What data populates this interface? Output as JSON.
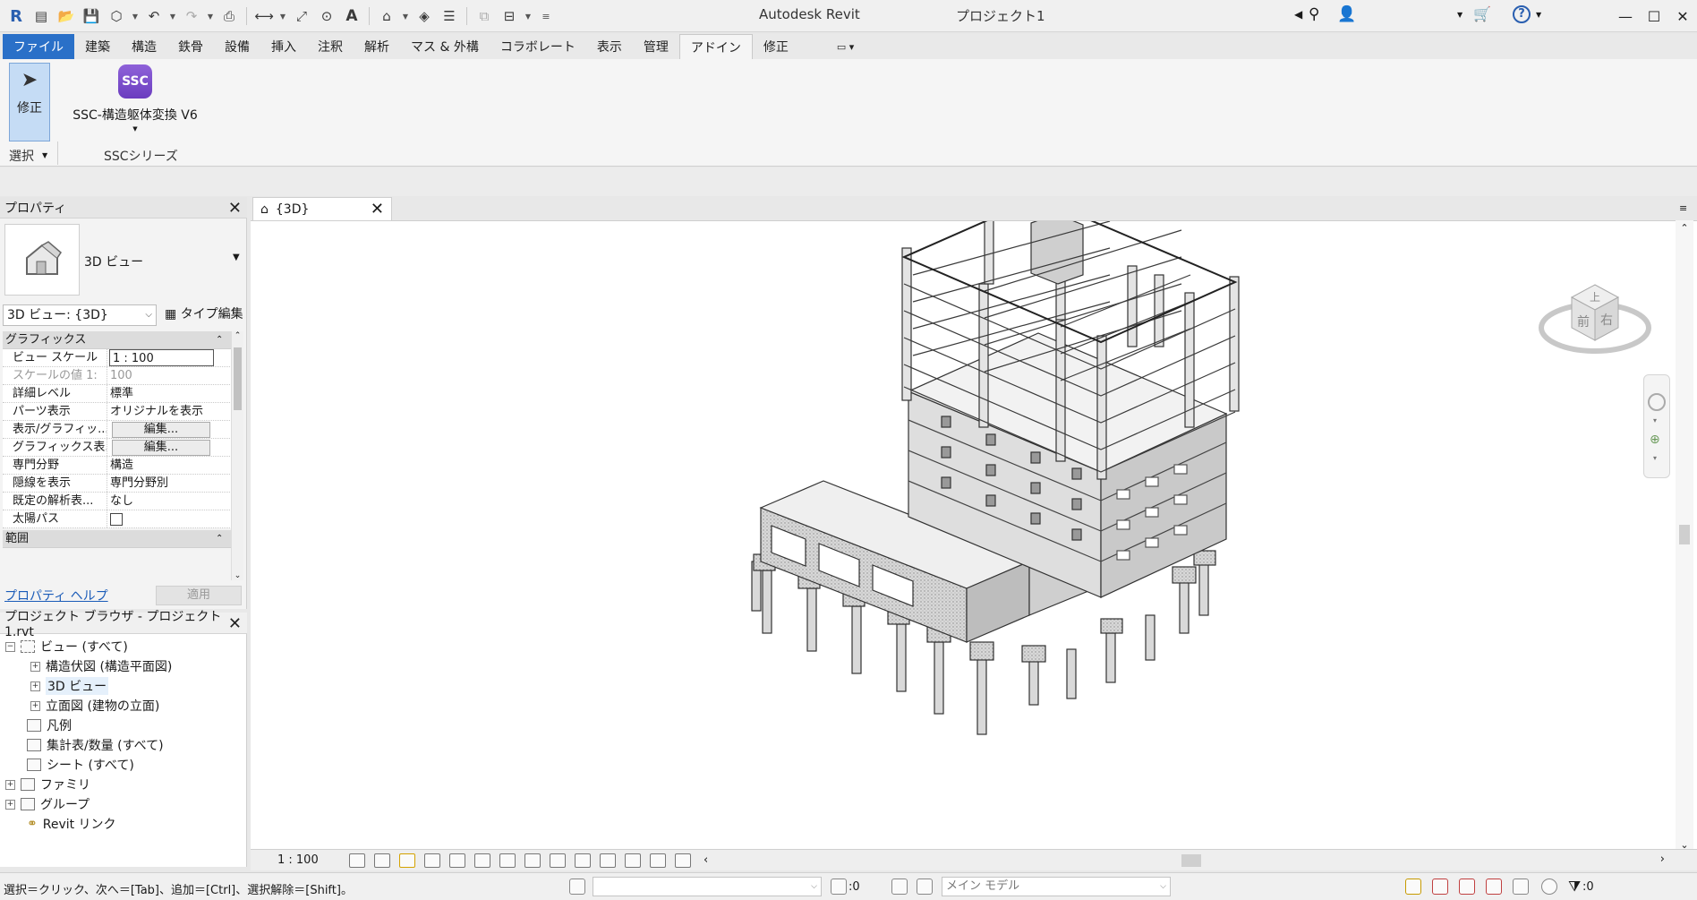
{
  "titlebar": {
    "app_title": "Autodesk Revit",
    "project_title": "プロジェクト1"
  },
  "menu": {
    "tabs": [
      "ファイル",
      "建築",
      "構造",
      "鉄骨",
      "設備",
      "挿入",
      "注釈",
      "解析",
      "マス & 外構",
      "コラボレート",
      "表示",
      "管理",
      "アドイン",
      "修正"
    ],
    "active": "アドイン"
  },
  "ribbon": {
    "modify_label": "修正",
    "select_label": "選択",
    "addin_icon_text": "SSC",
    "addin_label": "SSC-構造躯体変換 V6",
    "group_label": "SSCシリーズ"
  },
  "properties": {
    "title": "プロパティ",
    "type_name": "3D ビュー",
    "view_selector": "3D ビュー: {3D}",
    "edit_type": "タイプ編集",
    "section_graphics": "グラフィックス",
    "rows": [
      {
        "label": "ビュー スケール",
        "value": "1 : 100"
      },
      {
        "label": "スケールの値    1:",
        "value": "100"
      },
      {
        "label": "詳細レベル",
        "value": "標準"
      },
      {
        "label": "パーツ表示",
        "value": "オリジナルを表示"
      },
      {
        "label": "表示/グラフィッ...",
        "value": "編集..."
      },
      {
        "label": "グラフィックス表...",
        "value": "編集..."
      },
      {
        "label": "専門分野",
        "value": "構造"
      },
      {
        "label": "隠線を表示",
        "value": "専門分野別"
      },
      {
        "label": "既定の解析表...",
        "value": "なし"
      },
      {
        "label": "太陽パス",
        "value": ""
      }
    ],
    "section_extents": "範囲",
    "help_link": "プロパティ ヘルプ",
    "apply": "適用"
  },
  "browser": {
    "title": "プロジェクト ブラウザ - プロジェクト1.rvt",
    "nodes": {
      "views": "ビュー (すべて)",
      "structural_plans": "構造伏図 (構造平面図)",
      "views_3d": "3D ビュー",
      "elevations": "立面図 (建物の立面)",
      "legends": "凡例",
      "schedules": "集計表/数量 (すべて)",
      "sheets": "シート (すべて)",
      "families": "ファミリ",
      "groups": "グループ",
      "links": "Revit リンク"
    }
  },
  "view": {
    "tab_label": "{3D}",
    "scale": "1 : 100",
    "cube_top": "上",
    "cube_front": "前",
    "cube_right": "右"
  },
  "statusbar": {
    "text": "選択＝クリック、次へ＝[Tab]、追加＝[Ctrl]、選択解除＝[Shift]。",
    "count": ":0",
    "model": "メイン モデル",
    "filter_count": ":0"
  },
  "colors": {
    "file_tab": "#2a70c8",
    "selected": "#c5dcf5",
    "addin_icon": "#7a4cc9"
  }
}
